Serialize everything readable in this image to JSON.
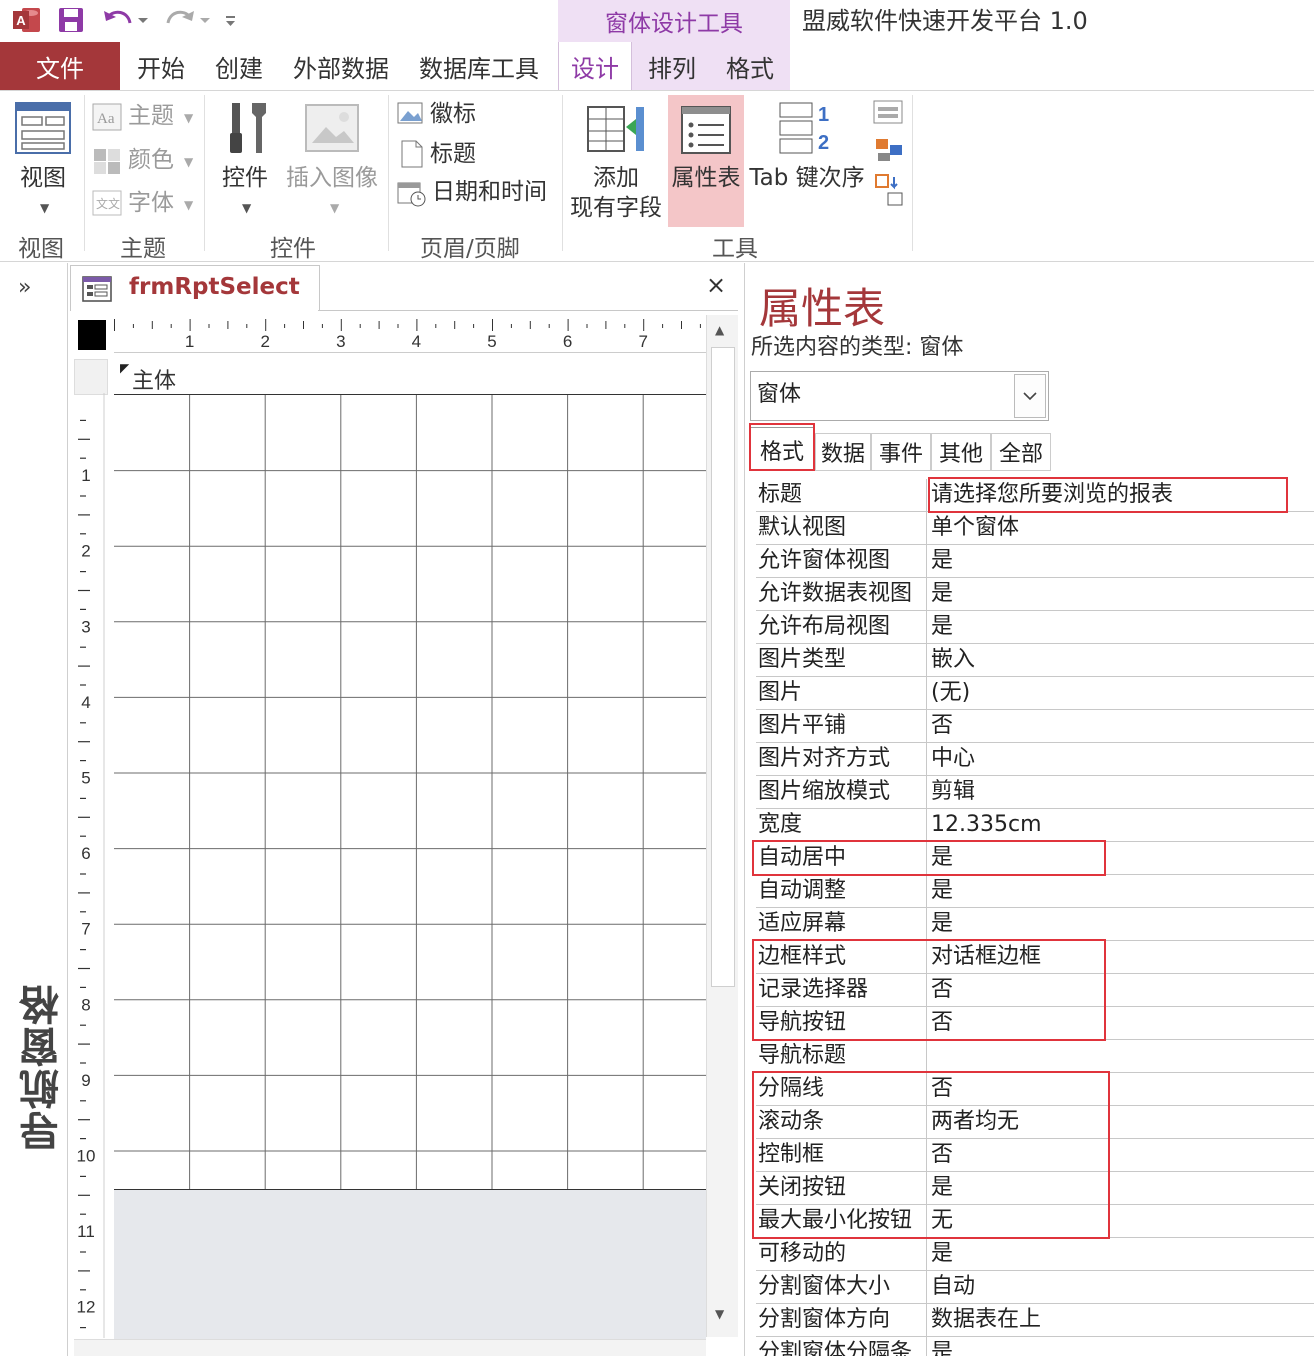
{
  "window": {
    "title": "盟威软件快速开发平台 1.0",
    "contextual_group": "窗体设计工具"
  },
  "ribbon_tabs": {
    "file": "文件",
    "home": "开始",
    "create": "创建",
    "external_data": "外部数据",
    "database_tools": "数据库工具",
    "design": "设计",
    "arrange": "排列",
    "format": "格式"
  },
  "ribbon": {
    "views": {
      "view_button": "视图",
      "group": "视图"
    },
    "themes": {
      "themes": "主题",
      "colors": "颜色",
      "fonts": "字体",
      "group": "主题"
    },
    "controls": {
      "controls": "控件",
      "insert_image": "插入图像",
      "group": "控件"
    },
    "header_footer": {
      "logo": "徽标",
      "title": "标题",
      "datetime": "日期和时间",
      "group": "页眉/页脚"
    },
    "tools": {
      "add_fields_line1": "添加",
      "add_fields_line2": "现有字段",
      "property_sheet": "属性表",
      "tab_order": "Tab 键次序",
      "group": "工具"
    }
  },
  "nav_pane": {
    "title": "导航窗格",
    "expand": "»"
  },
  "document": {
    "tab_label": "frmRptSelect",
    "close": "×",
    "section": "主体",
    "h_ruler": [
      "1",
      "2",
      "3",
      "4",
      "5",
      "6",
      "7"
    ],
    "v_ruler": [
      "1",
      "2",
      "3",
      "4",
      "5",
      "6",
      "7",
      "8",
      "9",
      "10",
      "11",
      "12"
    ]
  },
  "property_sheet": {
    "title": "属性表",
    "selection_type": "所选内容的类型: 窗体",
    "selector_value": "窗体",
    "tabs": [
      "格式",
      "数据",
      "事件",
      "其他",
      "全部"
    ],
    "active_tab": "格式",
    "rows": [
      {
        "name": "标题",
        "value": "请选择您所要浏览的报表"
      },
      {
        "name": "默认视图",
        "value": "单个窗体"
      },
      {
        "name": "允许窗体视图",
        "value": "是"
      },
      {
        "name": "允许数据表视图",
        "value": "是"
      },
      {
        "name": "允许布局视图",
        "value": "是"
      },
      {
        "name": "图片类型",
        "value": "嵌入"
      },
      {
        "name": "图片",
        "value": "(无)"
      },
      {
        "name": "图片平铺",
        "value": "否"
      },
      {
        "name": "图片对齐方式",
        "value": "中心"
      },
      {
        "name": "图片缩放模式",
        "value": "剪辑"
      },
      {
        "name": "宽度",
        "value": "12.335cm"
      },
      {
        "name": "自动居中",
        "value": "是"
      },
      {
        "name": "自动调整",
        "value": "是"
      },
      {
        "name": "适应屏幕",
        "value": "是"
      },
      {
        "name": "边框样式",
        "value": "对话框边框"
      },
      {
        "name": "记录选择器",
        "value": "否"
      },
      {
        "name": "导航按钮",
        "value": "否"
      },
      {
        "name": "导航标题",
        "value": ""
      },
      {
        "name": "分隔线",
        "value": "否"
      },
      {
        "name": "滚动条",
        "value": "两者均无"
      },
      {
        "name": "控制框",
        "value": "否"
      },
      {
        "name": "关闭按钮",
        "value": "是"
      },
      {
        "name": "最大最小化按钮",
        "value": "无"
      },
      {
        "name": "可移动的",
        "value": "是"
      },
      {
        "name": "分割窗体大小",
        "value": "自动"
      },
      {
        "name": "分割窗体方向",
        "value": "数据表在上"
      },
      {
        "name": "分割窗体分隔条",
        "value": "是"
      }
    ]
  },
  "colors": {
    "accent": "#a4373a",
    "contextual": "#8e3aa6",
    "highlight": "#e0343c"
  }
}
